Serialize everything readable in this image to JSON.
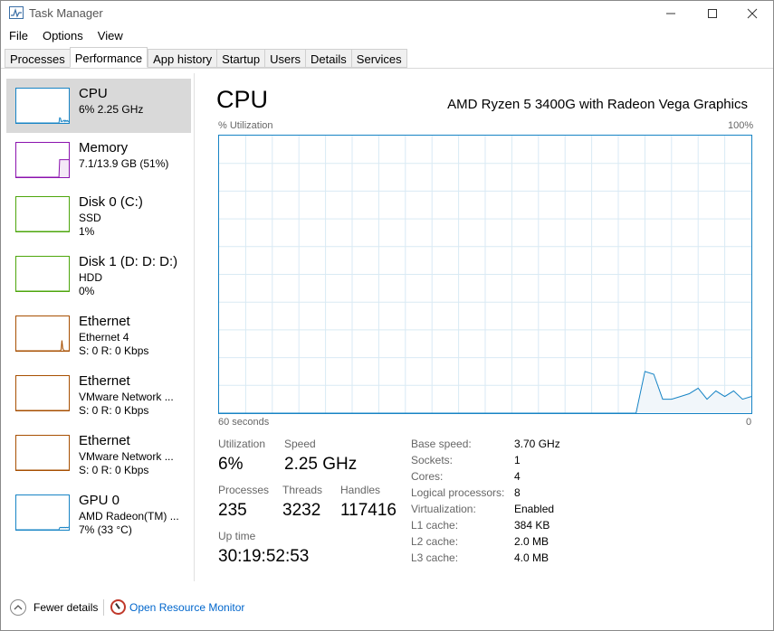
{
  "window": {
    "title": "Task Manager"
  },
  "menu": [
    "File",
    "Options",
    "View"
  ],
  "tabs": [
    "Processes",
    "Performance",
    "App history",
    "Startup",
    "Users",
    "Details",
    "Services"
  ],
  "active_tab": "Performance",
  "sidebar": {
    "items": [
      {
        "name": "CPU",
        "line1": "6%  2.25 GHz",
        "line2": "",
        "color": "#1784c5",
        "fill": "#f1f6fa",
        "values": [
          0,
          0,
          0,
          0,
          0,
          0,
          0,
          0,
          0,
          0,
          0,
          0,
          0,
          0,
          0,
          0,
          0,
          0,
          0,
          0,
          0,
          0,
          0,
          0,
          0,
          0,
          0,
          0,
          0,
          0,
          0,
          0,
          0,
          0,
          0,
          0,
          0,
          0,
          0,
          0,
          0,
          0,
          0,
          0,
          0,
          0,
          0,
          0,
          0,
          0,
          0,
          0,
          0,
          0,
          0,
          0,
          0,
          15,
          14,
          4,
          5,
          5,
          6,
          8,
          4,
          7,
          5,
          7,
          4,
          6
        ]
      },
      {
        "name": "Memory",
        "line1": "7.1/13.9 GB (51%)",
        "line2": "",
        "color": "#8b12ae",
        "fill": "#f4e9f7",
        "values": [
          0,
          0,
          0,
          0,
          0,
          0,
          0,
          0,
          0,
          0,
          0,
          0,
          0,
          0,
          0,
          0,
          0,
          0,
          0,
          0,
          0,
          0,
          0,
          0,
          0,
          0,
          0,
          0,
          0,
          0,
          0,
          0,
          0,
          0,
          0,
          0,
          0,
          0,
          0,
          0,
          0,
          0,
          0,
          0,
          0,
          0,
          0,
          0,
          0,
          0,
          0,
          0,
          0,
          0,
          0,
          0,
          0,
          51,
          51,
          51,
          51,
          51,
          51,
          51,
          51,
          51,
          51,
          51,
          51,
          51
        ]
      },
      {
        "name": "Disk 0 (C:)",
        "line1": "SSD",
        "line2": "1%",
        "color": "#4da60c",
        "fill": "#eef6e8",
        "values": [
          0,
          0,
          0,
          0,
          0,
          0,
          0,
          0,
          0,
          0
        ]
      },
      {
        "name": "Disk 1 (D: D: D:)",
        "line1": "HDD",
        "line2": "0%",
        "color": "#4da60c",
        "fill": "#eef6e8",
        "values": [
          0,
          0,
          0,
          0,
          0,
          0,
          0,
          0,
          0,
          0
        ]
      },
      {
        "name": "Ethernet",
        "line1": "Ethernet 4",
        "line2": "S: 0  R: 0 Kbps",
        "color": "#a74f01",
        "fill": "#f6ede5",
        "values": [
          0,
          0,
          0,
          0,
          0,
          0,
          0,
          0,
          0,
          0,
          0,
          0,
          0,
          0,
          0,
          0,
          0,
          0,
          0,
          0,
          0,
          0,
          0,
          0,
          0,
          0,
          0,
          0,
          0,
          0,
          0,
          0,
          0,
          0,
          0,
          0,
          0,
          0,
          0,
          0,
          0,
          0,
          0,
          0,
          0,
          0,
          0,
          0,
          0,
          0,
          0,
          0,
          0,
          0,
          0,
          0,
          0,
          0,
          0,
          5,
          30,
          8,
          3,
          0,
          0,
          0,
          0,
          0,
          0,
          0
        ]
      },
      {
        "name": "Ethernet",
        "line1": "VMware Network ...",
        "line2": "S: 0  R: 0 Kbps",
        "color": "#a74f01",
        "fill": "#f6ede5",
        "values": [
          0,
          0,
          0,
          0,
          0,
          0,
          0,
          0,
          0,
          0
        ]
      },
      {
        "name": "Ethernet",
        "line1": "VMware Network ...",
        "line2": "S: 0  R: 0 Kbps",
        "color": "#a74f01",
        "fill": "#f6ede5",
        "values": [
          0,
          0,
          0,
          0,
          0,
          0,
          0,
          0,
          0,
          0
        ]
      },
      {
        "name": "GPU 0",
        "line1": "AMD Radeon(TM) ...",
        "line2": "7% (33 °C)",
        "color": "#1784c5",
        "fill": "#f1f6fa",
        "values": [
          0,
          0,
          0,
          0,
          0,
          0,
          0,
          0,
          0,
          0,
          0,
          0,
          0,
          0,
          0,
          0,
          0,
          0,
          0,
          0,
          0,
          0,
          0,
          0,
          0,
          0,
          0,
          0,
          0,
          0,
          0,
          0,
          0,
          0,
          0,
          0,
          0,
          0,
          0,
          0,
          0,
          0,
          0,
          0,
          0,
          0,
          0,
          0,
          0,
          0,
          0,
          0,
          0,
          0,
          0,
          0,
          0,
          6,
          7,
          6,
          7,
          6,
          7,
          6,
          7,
          6,
          7,
          6,
          7,
          7
        ]
      }
    ]
  },
  "main": {
    "title": "CPU",
    "cpu_model": "AMD Ryzen 5 3400G with Radeon Vega Graphics",
    "graph_label_left": "% Utilization",
    "graph_label_right": "100%",
    "axis_left": "60 seconds",
    "axis_right": "0",
    "stats": {
      "utilization_label": "Utilization",
      "utilization": "6%",
      "speed_label": "Speed",
      "speed": "2.25 GHz",
      "processes_label": "Processes",
      "processes": "235",
      "threads_label": "Threads",
      "threads": "3232",
      "handles_label": "Handles",
      "handles": "117416",
      "uptime_label": "Up time",
      "uptime": "30:19:52:53"
    },
    "specs": [
      {
        "label": "Base speed:",
        "value": "3.70 GHz"
      },
      {
        "label": "Sockets:",
        "value": "1"
      },
      {
        "label": "Cores:",
        "value": "4"
      },
      {
        "label": "Logical processors:",
        "value": "8"
      },
      {
        "label": "Virtualization:",
        "value": "Enabled"
      },
      {
        "label": "L1 cache:",
        "value": "384 KB"
      },
      {
        "label": "L2 cache:",
        "value": "2.0 MB"
      },
      {
        "label": "L3 cache:",
        "value": "4.0 MB"
      }
    ]
  },
  "chart_data": {
    "type": "area",
    "ylim": [
      0,
      100
    ],
    "xlim": [
      60,
      0
    ],
    "x": [
      60,
      58,
      56,
      54,
      52,
      50,
      48,
      46,
      44,
      42,
      40,
      38,
      36,
      34,
      32,
      30,
      28,
      26,
      24,
      22,
      20,
      18,
      16,
      14,
      13,
      12,
      11,
      10,
      9,
      8,
      7,
      6,
      5,
      4,
      3,
      2,
      1,
      0
    ],
    "values": [
      0,
      0,
      0,
      0,
      0,
      0,
      0,
      0,
      0,
      0,
      0,
      0,
      0,
      0,
      0,
      0,
      0,
      0,
      0,
      0,
      0,
      0,
      0,
      0,
      0,
      15,
      14,
      5,
      5,
      6,
      7,
      9,
      5,
      8,
      6,
      8,
      5,
      6
    ],
    "grid": true,
    "colors": {
      "line": "#1784c5",
      "fill": "#f1f6fa",
      "grid": "#d9eaf4"
    }
  },
  "footer": {
    "fewer_details": "Fewer details",
    "open_resource_monitor": "Open Resource Monitor"
  }
}
